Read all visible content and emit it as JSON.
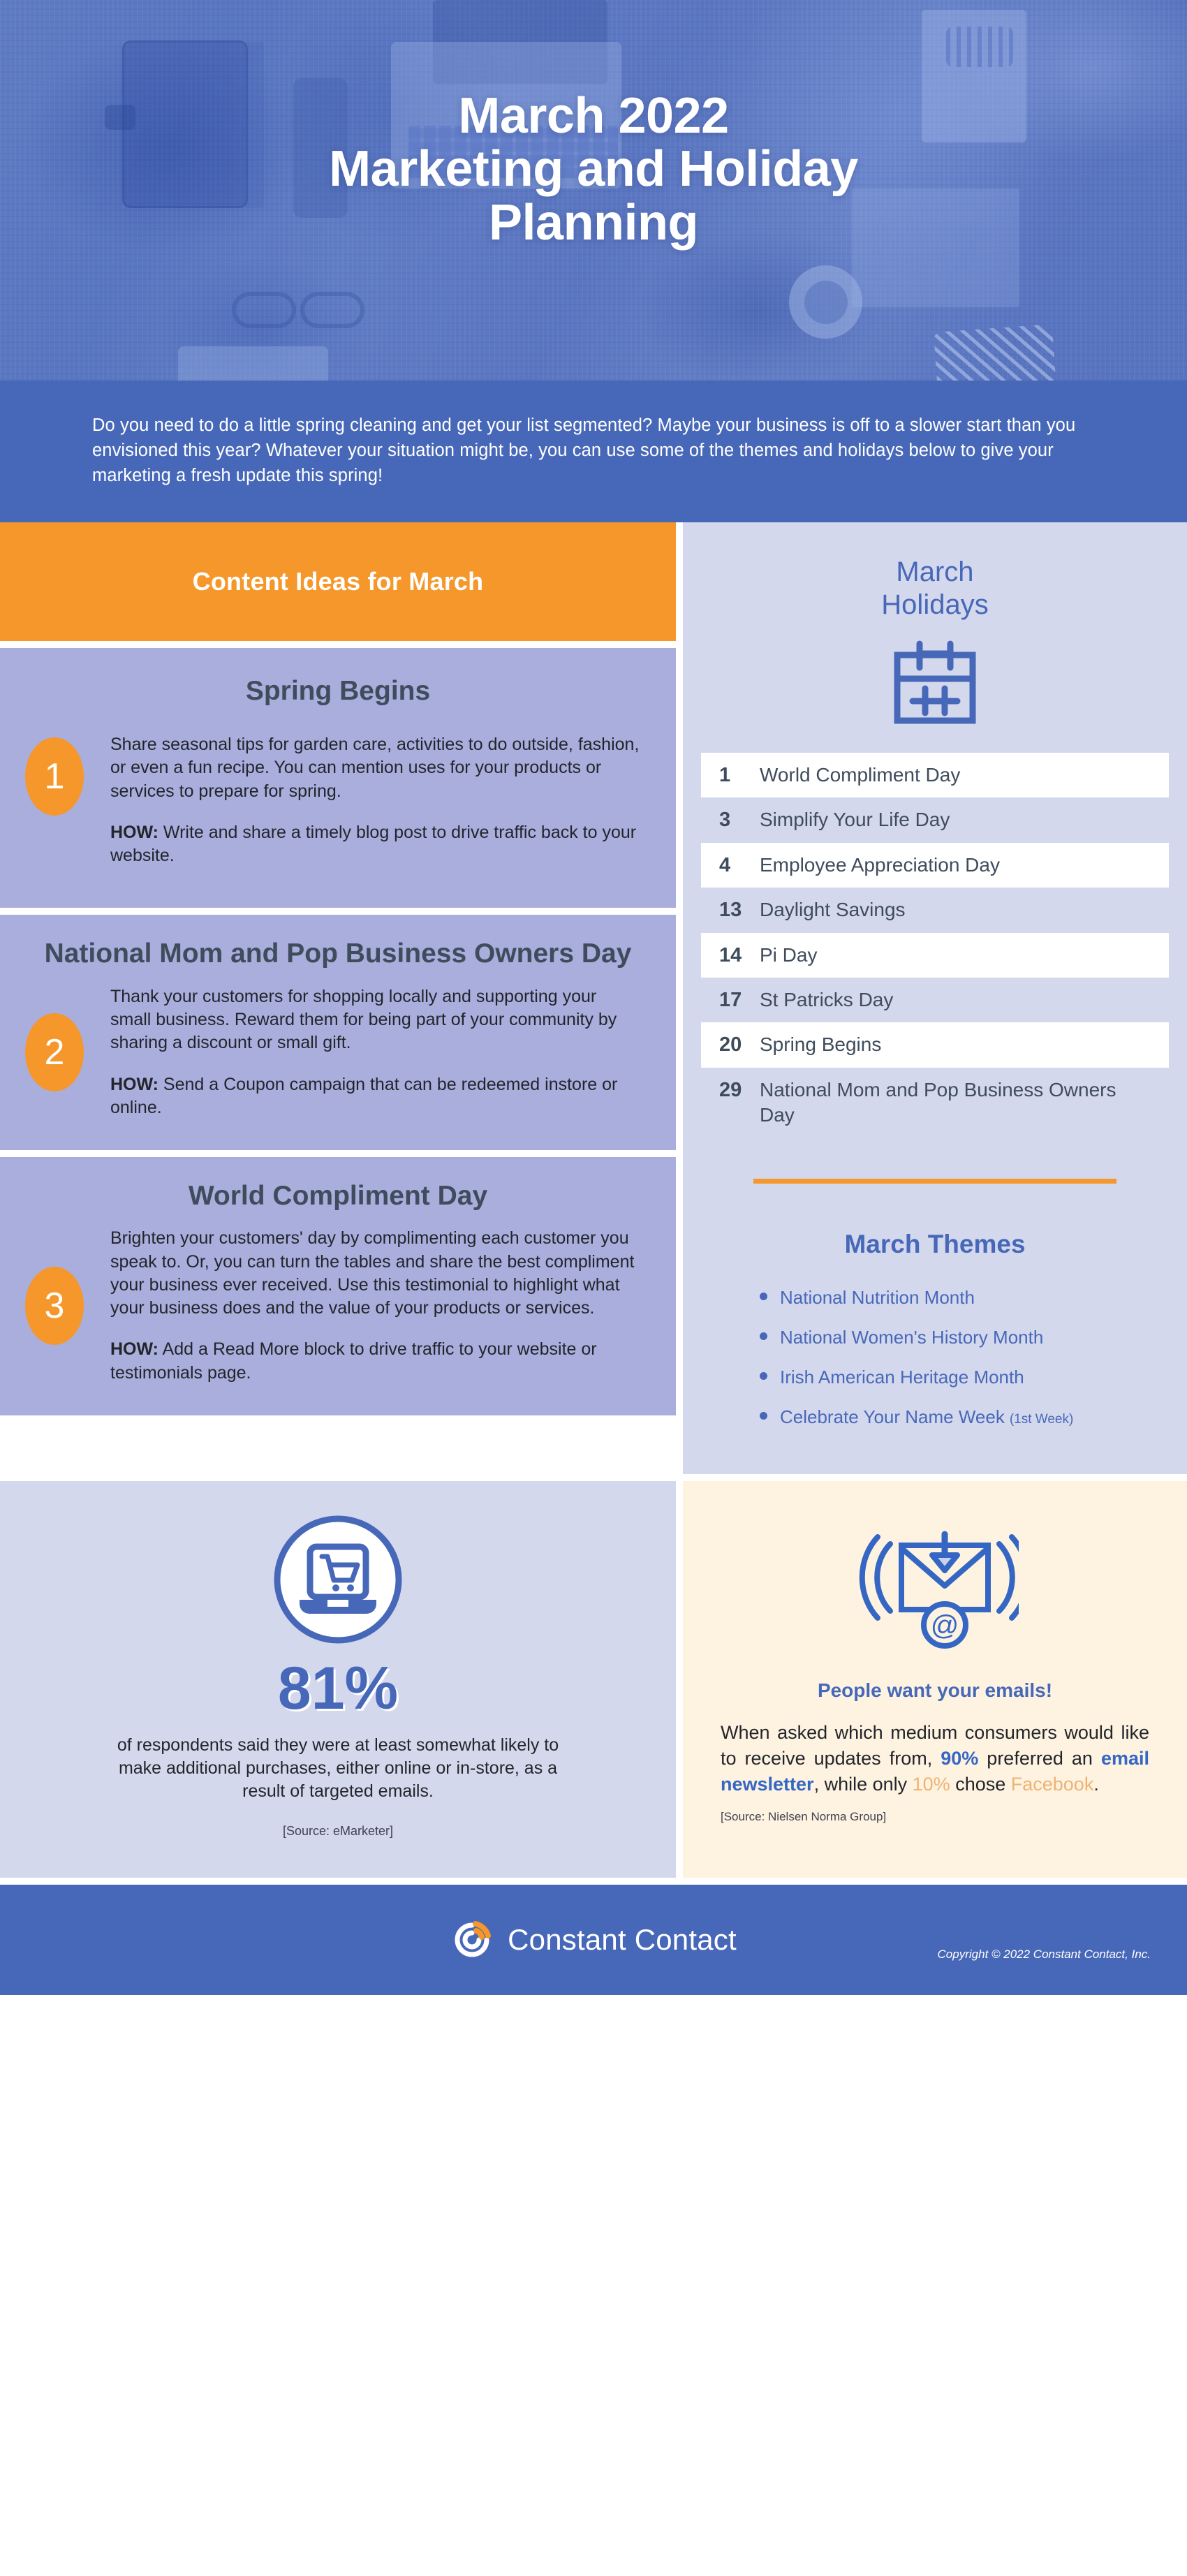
{
  "hero": {
    "title_line1": "March 2022",
    "title_line2": "Marketing and Holiday",
    "title_line3": "Planning"
  },
  "intro": {
    "text": "Do you need to do a little spring cleaning and get your list segmented? Maybe your business is off to a slower start than you envisioned this year? Whatever your situation might be, you can use some of the themes and holidays below to give your marketing a fresh update this spring!"
  },
  "content_ideas": {
    "header": "Content Ideas for March",
    "items": [
      {
        "number": "1",
        "title": "Spring Begins",
        "body": "Share seasonal tips for garden care, activities to do outside, fashion, or even a fun recipe. You can mention uses for your products or services to prepare for spring.",
        "how_label": "HOW:",
        "how_text": " Write and share a timely blog post to drive traffic back to your website."
      },
      {
        "number": "2",
        "title": "National Mom and Pop Business Owners Day",
        "body": "Thank your customers for shopping locally and supporting your small business. Reward them for being part of your community by sharing a discount or small gift.",
        "how_label": "HOW:",
        "how_text": " Send a Coupon campaign that can be redeemed instore or online."
      },
      {
        "number": "3",
        "title": "World Compliment Day",
        "body": "Brighten your customers' day by complimenting each customer you speak to. Or, you can turn the tables and share the best compliment your business ever received. Use this testimonial to highlight what your business does and the value of your products or services.",
        "how_label": "HOW:",
        "how_text": " Add a Read More block to drive traffic to your website or testimonials page."
      }
    ]
  },
  "holidays": {
    "title_line1": "March",
    "title_line2": "Holidays",
    "icon": "calendar-icon",
    "items": [
      {
        "day": "1",
        "name": "World Compliment Day"
      },
      {
        "day": "3",
        "name": "Simplify Your Life Day"
      },
      {
        "day": "4",
        "name": "Employee Appreciation Day"
      },
      {
        "day": "13",
        "name": "Daylight Savings"
      },
      {
        "day": "14",
        "name": "Pi Day"
      },
      {
        "day": "17",
        "name": "St Patricks Day"
      },
      {
        "day": "20",
        "name": "Spring Begins"
      },
      {
        "day": "29",
        "name": "National Mom and Pop Business Owners Day"
      }
    ]
  },
  "themes": {
    "title": "March Themes",
    "items": [
      {
        "label": "National Nutrition Month",
        "sub": ""
      },
      {
        "label": "National Women's History Month",
        "sub": ""
      },
      {
        "label": "Irish American Heritage Month",
        "sub": ""
      },
      {
        "label": "Celebrate Your Name Week",
        "sub": "(1st Week)"
      }
    ]
  },
  "stat": {
    "icon": "online-shopping-icon",
    "value": "81%",
    "description": "of respondents said they were at least somewhat likely to make additional purchases, either online or in-store, as a result of targeted emails.",
    "source": "[Source: eMarketer]"
  },
  "email_stat": {
    "icon": "email-at-icon",
    "headline": "People want your emails!",
    "body_part1": "When asked which medium consumers would like to receive updates from, ",
    "highlight1": "90%",
    "body_part2": " preferred an ",
    "highlight2": "email newsletter",
    "body_part3": ", while only ",
    "highlight3": "10%",
    "body_part4": " chose ",
    "highlight4": "Facebook",
    "body_part5": ".",
    "source": "[Source: Nielsen Norma Group]"
  },
  "footer": {
    "brand": "Constant Contact",
    "copyright": "Copyright © 2022 Constant Contact, Inc."
  },
  "colors": {
    "brand_blue": "#4768b8",
    "accent_orange": "#f5972a",
    "lavender_dark": "#a9aedd",
    "lavender_light": "#d4d8ed",
    "cream": "#fdf3e0",
    "slate": "#3f4c5c"
  }
}
